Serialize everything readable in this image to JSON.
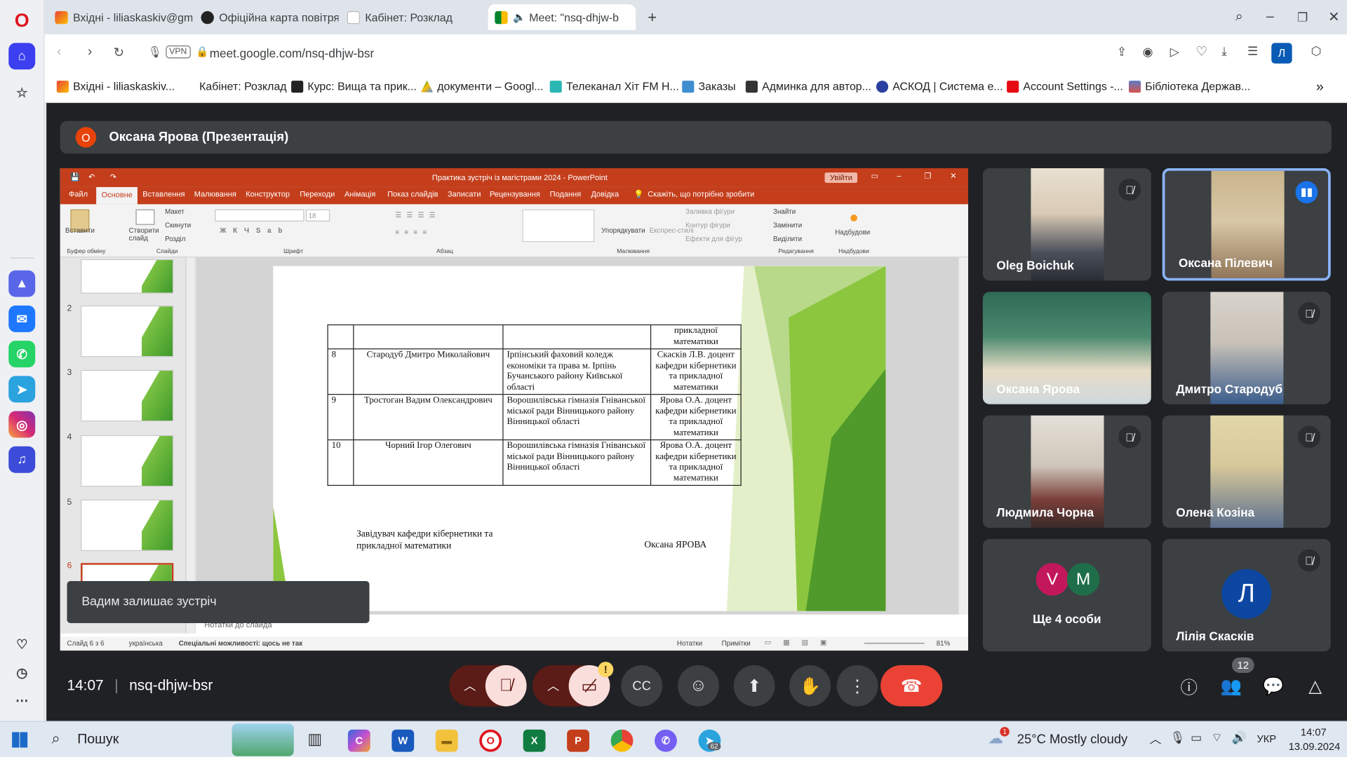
{
  "browser": {
    "tabs": [
      {
        "title": "Вхідні - liliaskaskiv@gmai",
        "icon": "gmail-icon"
      },
      {
        "title": "Офіційна карта повітряна",
        "icon": "alert-map-icon"
      },
      {
        "title": "Кабінет: Розклад",
        "icon": "page-icon"
      },
      {
        "title": "Meet: \"nsq-dhjw-b",
        "icon": "meet-icon"
      }
    ],
    "new_tab": "+",
    "vpn": "VPN",
    "url": "meet.google.com/nsq-dhjw-bsr",
    "profile": "Л",
    "bookmarks": [
      "Вхідні - liliaskaskiv...",
      "Кабінет: Розклад",
      "Курс: Вища та прик...",
      "документи – Googl...",
      "Телеканал Хіт FM Н...",
      "Заказы",
      "Админка для автор...",
      "АСКОД | Система е...",
      "Account Settings -...",
      "Бібліотека Держав..."
    ],
    "more": "»"
  },
  "meet": {
    "presenter": "Оксана Ярова (Презентація)",
    "presenter_initial": "О",
    "time": "14:07",
    "code": "nsq-dhjw-bsr",
    "toast": "Вадим залишає зустріч",
    "participants_count": "12",
    "cam_warning": "!",
    "tiles": [
      {
        "name": "Oleg Boichuk",
        "muted": true
      },
      {
        "name": "Оксана Пілевич",
        "muted": false,
        "speaking": true
      },
      {
        "name": "Оксана Ярова",
        "muted": false
      },
      {
        "name": "Дмитро Стародуб",
        "muted": true
      },
      {
        "name": "Людмила Чорна",
        "muted": true
      },
      {
        "name": "Олена Козіна",
        "muted": true
      },
      {
        "name": "Ще 4 особи",
        "initials": [
          "V",
          "M"
        ]
      },
      {
        "name": "Лілія Скасків",
        "initial": "Л",
        "muted": true
      }
    ]
  },
  "ppt": {
    "title": "Практика зустріч із магістрами 2024 - PowerPoint",
    "signin": "Увійти",
    "menu": [
      "Файл",
      "Основне",
      "Вставлення",
      "Малювання",
      "Конструктор",
      "Переходи",
      "Анімація",
      "Показ слайдів",
      "Записати",
      "Рецензування",
      "Подання",
      "Довідка"
    ],
    "tellme": "Скажіть, що потрібно зробити",
    "ribbon": {
      "paste": "Вставити",
      "new_slide": "Створити слайд",
      "layout": "Макет",
      "reset": "Скинути",
      "section": "Розділ",
      "arrange": "Упорядкувати",
      "quick_styles": "Експрес-стилі",
      "fill": "Заливка фігури",
      "outline": "Контур фігури",
      "effects": "Ефекти для фігур",
      "find": "Знайти",
      "replace": "Замінити",
      "select": "Виділити",
      "addins": "Надбудови",
      "font_size": "18",
      "groups": [
        "Буфер обміну",
        "Слайди",
        "Шрифт",
        "Абзац",
        "Малювання",
        "Редагування",
        "Надбудови"
      ]
    },
    "thumbs": [
      "2",
      "3",
      "4",
      "5",
      "6"
    ],
    "notes": "Нотатки до слайда",
    "status": {
      "slide": "Слайд 6 з 6",
      "lang": "українська",
      "access": "Спеціальні можливості: щось не так",
      "notes_btn": "Нотатки",
      "comments": "Примітки",
      "zoom": "81%"
    },
    "table_rows": [
      {
        "num": "",
        "name": "",
        "org": "",
        "sup": "прикладної математики"
      },
      {
        "num": "8",
        "name": "Стародуб Дмитро Миколайович",
        "org": "Ірпінський фаховий коледж економіки та права м. Ірпінь Бучанського району Київської області",
        "sup": "Скасків Л.В. доцент кафедри кібернетики та прикладної математики"
      },
      {
        "num": "9",
        "name": "Тростоган Вадим Олександрович",
        "org": "Ворошилівська гімназія Гніванської міської ради Вінницького району Вінницької області",
        "sup": "Ярова О.А. доцент кафедри кібернетики та прикладної математики"
      },
      {
        "num": "10",
        "name": "Чорний Ігор Олегович",
        "org": "Ворошилівська гімназія Гніванської міської ради Вінницького району Вінницької області",
        "sup": "Ярова О.А. доцент кафедри кібернетики та прикладної математики"
      }
    ],
    "signature_left": "Завідувач кафедри кібернетики та прикладної математики",
    "signature_right": "Оксана ЯРОВА"
  },
  "taskbar": {
    "search": "Пошук",
    "weather": "25°C  Mostly cloudy",
    "lang": "УКР",
    "time": "14:07",
    "date": "13.09.2024",
    "weather_badge": "1",
    "viber_badge": "62"
  },
  "colors": {
    "meet_bg": "#202124",
    "hangup": "#ea4335",
    "ppt_red": "#c43e1c",
    "speaking": "#8ab4f8"
  }
}
